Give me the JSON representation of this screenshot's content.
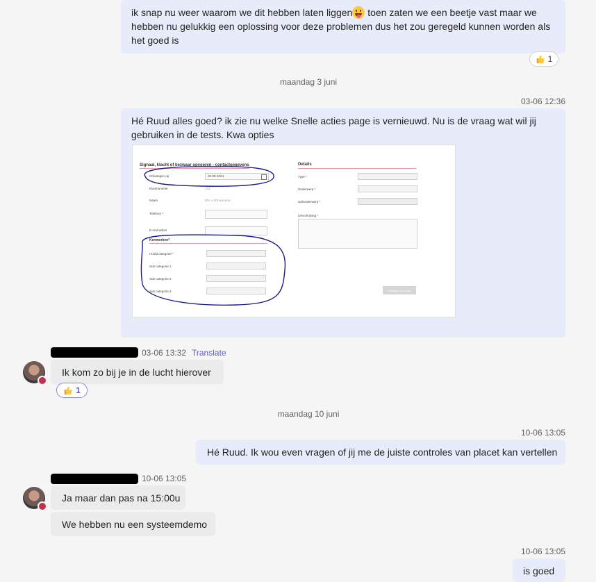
{
  "messages": {
    "m1_text": "ik snap nu weer waarom we dit hebben laten liggen",
    "m1_text_after": " toen zaten we een beetje vast maar we hebben nu gelukkig een oplossing voor deze problemen dus het zou geregeld kunnen worden als het goed is",
    "m1_reaction_count": "1",
    "divider1": "maandag 3 juni",
    "m2_stamp": "03-06 12:36",
    "m2_text": "Hé Ruud alles goed? ik zie nu welke Snelle acties page is vernieuwd. Nu is de vraag wat wil jij gebruiken in de tests. Kwa opties",
    "m3_stamp": "03-06 13:32",
    "m3_translate": "Translate",
    "m3_text": "Ik kom zo bij je in de lucht hierover",
    "m3_reaction_count": "1",
    "divider2": "maandag 10 juni",
    "m4_stamp": "10-06 13:05",
    "m4_text": "Hé Ruud. Ik wou even vragen of jij me de juiste controles van placet kan vertellen",
    "m5_stamp": "10-06 13:05",
    "m5_text1": "Ja maar dan pas na 15:00u",
    "m5_text2": "We hebben nu een systeemdemo",
    "m6_stamp": "10-06 13:05",
    "m6_text": "is goed"
  },
  "form": {
    "left_title": "Signaal, klacht of bezwaar opvoeren - contactgegevens",
    "ontvangen_label": "Ontvangen op",
    "ontvangen_value": "03-06-2024",
    "klantnummer_label": "Klantnummer",
    "klantnummer_value": "123",
    "naam_label": "Naam",
    "naam_value": "Dhr. A.Rhxxxxxxxx",
    "telefoon_label": "Telefoon *",
    "email_label": "E-mail adres",
    "kenmerken_title": "Kenmerken*",
    "hoofd_label": "Hoofd categorie *",
    "sub1_label": "Sub categorie 1",
    "sub2_label": "Sub categorie 2",
    "sub3_label": "Sub categorie 3",
    "right_title": "Details",
    "type_label": "Type *",
    "onderwerp_label": "Onderwerp *",
    "subonderwerp_label": "Subonderwerp *",
    "omschrijving_label": "Omschrijving *",
    "button_label": "Opslaan en verder"
  },
  "colors": {
    "outgoing_bubble": "#e8ebfa",
    "incoming_bubble": "#ebebeb",
    "accent": "#5b5fc7",
    "presence_busy": "#c4314b",
    "annotation_ink": "#1a1a8c"
  },
  "icons": {
    "reaction": "thumbs-up-icon",
    "emoji": "grinning-tongue-emoji-icon",
    "calendar": "calendar-icon"
  }
}
